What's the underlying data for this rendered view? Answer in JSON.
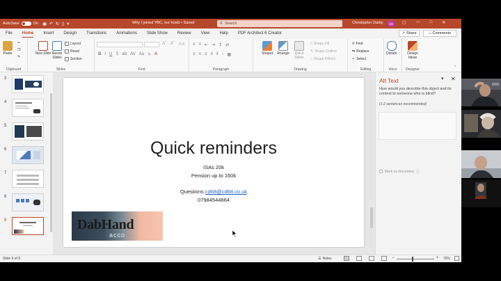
{
  "titlebar": {
    "autosave_label": "AutoSave",
    "autosave_state": "On",
    "doc_title": "Why I joined YBC, our hosts  •  Saved",
    "search_placeholder": "Search",
    "user_name": "Christopher Darby",
    "user_initials": "CD"
  },
  "tabs": [
    "File",
    "Home",
    "Insert",
    "Design",
    "Transitions",
    "Animations",
    "Slide Show",
    "Review",
    "View",
    "Help",
    "PDF Architect 6 Creator"
  ],
  "active_tab": "Home",
  "share_label": "Share",
  "comments_label": "Comments",
  "ribbon": {
    "clipboard": {
      "label": "Clipboard",
      "paste": "Paste"
    },
    "slides": {
      "label": "Slides",
      "new_slide": "New Slide",
      "reuse_slides": "Reuse Slides",
      "layout": "Layout",
      "reset": "Reset",
      "section": "Section"
    },
    "font": {
      "label": "Font"
    },
    "paragraph": {
      "label": "Paragraph"
    },
    "drawing": {
      "label": "Drawing",
      "shapes": "Shapes",
      "arrange": "Arrange",
      "quick_styles": "Quick Styles",
      "shape_fill": "Shape Fill",
      "shape_outline": "Shape Outline",
      "shape_effects": "Shape Effects"
    },
    "editing": {
      "label": "Editing",
      "find": "Find",
      "replace": "Replace",
      "select": "Select"
    },
    "voice": {
      "label": "Voice",
      "dictate": "Dictate"
    },
    "designer": {
      "label": "Designer",
      "design_ideas": "Design Ideas"
    }
  },
  "thumbnails": [
    {
      "num": "3"
    },
    {
      "num": "4"
    },
    {
      "num": "5"
    },
    {
      "num": "6"
    },
    {
      "num": "7"
    },
    {
      "num": "8"
    },
    {
      "num": "9"
    }
  ],
  "slide": {
    "title": "Quick reminders",
    "line1": "ISAs 20k",
    "line2": "Pension up to 160k",
    "questions_label": "Questions",
    "email": "cd68@cd68.co.uk",
    "phone": "07984544864",
    "logo_text": "DabHand",
    "logo_sub": "acco"
  },
  "alt_text_pane": {
    "title": "Alt Text",
    "question": "How would you describe this object and its context to someone who is blind?",
    "hint": "(1-2 sentences recommended)",
    "decorative_label": "Mark as decorative"
  },
  "status": {
    "slide_info": "Slide 9 of 9",
    "notes_label": "Notes",
    "zoom": "70%"
  },
  "colors": {
    "accent": "#b7472a",
    "link": "#1f5fbf"
  }
}
